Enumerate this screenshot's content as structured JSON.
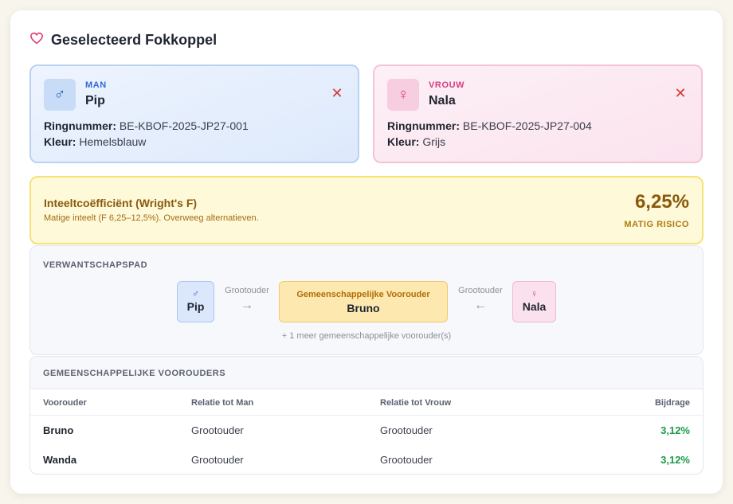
{
  "header": {
    "title": "Geselecteerd Fokkoppel",
    "icon": "heart-icon"
  },
  "male": {
    "gender_label": "MAN",
    "symbol": "♂",
    "name": "Pip",
    "ring_label": "Ringnummer:",
    "ring_value": "BE-KBOF-2025-JP27-001",
    "color_label": "Kleur:",
    "color_value": "Hemelsblauw"
  },
  "female": {
    "gender_label": "VROUW",
    "symbol": "♀",
    "name": "Nala",
    "ring_label": "Ringnummer:",
    "ring_value": "BE-KBOF-2025-JP27-004",
    "color_label": "Kleur:",
    "color_value": "Grijs"
  },
  "close_symbol": "✕",
  "inbreeding": {
    "title": "Inteeltcoëfficiënt (Wright's F)",
    "description": "Matige inteelt (F 6,25–12,5%). Overweeg alternatieven.",
    "value": "6,25%",
    "risk": "MATIG RISICO"
  },
  "path": {
    "section_label": "VERWANTSCHAPSPAD",
    "male_symbol": "♂",
    "male_name": "Pip",
    "left_edge_label": "Grootouder",
    "left_arrow": "→",
    "ancestor_label": "Gemeenschappelijke Voorouder",
    "ancestor_name": "Bruno",
    "right_edge_label": "Grootouder",
    "right_arrow": "←",
    "female_symbol": "♀",
    "female_name": "Nala",
    "more_text": "+ 1 meer gemeenschappelijke voorouder(s)"
  },
  "common": {
    "section_label": "GEMEENSCHAPPELIJKE VOOROUDERS",
    "columns": [
      "Voorouder",
      "Relatie tot Man",
      "Relatie tot Vrouw",
      "Bijdrage"
    ],
    "rows": [
      {
        "ancestor": "Bruno",
        "rel_male": "Grootouder",
        "rel_female": "Grootouder",
        "contribution": "3,12%"
      },
      {
        "ancestor": "Wanda",
        "rel_male": "Grootouder",
        "rel_female": "Grootouder",
        "contribution": "3,12%"
      }
    ]
  },
  "colors": {
    "male_accent": "#2f6bd6",
    "female_accent": "#d63b86",
    "warning": "#8a5a0b",
    "contribution": "#1c9a4a",
    "remove": "#d43a3a"
  }
}
